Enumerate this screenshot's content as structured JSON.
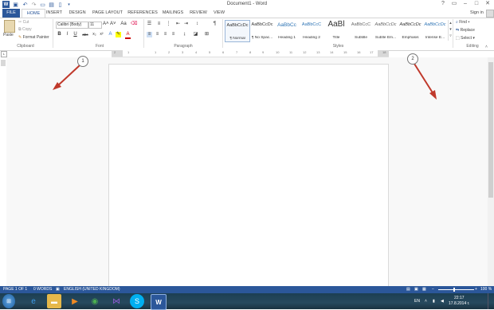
{
  "window": {
    "title": "Document1 - Word",
    "help": "?",
    "sign_in": "Sign in"
  },
  "tabs": [
    "FILE",
    "HOME",
    "INSERT",
    "DESIGN",
    "PAGE LAYOUT",
    "REFERENCES",
    "MAILINGS",
    "REVIEW",
    "VIEW"
  ],
  "clipboard": {
    "paste": "Paste",
    "cut": "Cut",
    "copy": "Copy",
    "format_painter": "Format Painter",
    "label": "Clipboard"
  },
  "font": {
    "name": "Calibri (Body)",
    "size": "11",
    "bold": "B",
    "italic": "I",
    "underline": "U",
    "strike": "abc",
    "sub": "x₂",
    "sup": "x²",
    "grow": "A˄",
    "shrink": "A˅",
    "case": "Aa",
    "label": "Font"
  },
  "paragraph": {
    "label": "Paragraph",
    "pilcrow": "¶"
  },
  "styles": {
    "label": "Styles",
    "items": [
      {
        "sample": "AaBbCcDc",
        "name": "¶ Normal"
      },
      {
        "sample": "AaBbCcDc",
        "name": "¶ No Spac..."
      },
      {
        "sample": "AaBbCc",
        "name": "Heading 1"
      },
      {
        "sample": "AaBbCcC",
        "name": "Heading 2"
      },
      {
        "sample": "AaBl",
        "name": "Title"
      },
      {
        "sample": "AaBbCcC",
        "name": "Subtitle"
      },
      {
        "sample": "AaBbCcDc",
        "name": "Subtle Em..."
      },
      {
        "sample": "AaBbCcDc",
        "name": "Emphasis"
      },
      {
        "sample": "AaBbCcDc",
        "name": "Intense E..."
      }
    ]
  },
  "editing": {
    "find": "Find",
    "replace": "Replace",
    "select": "Select",
    "label": "Editing"
  },
  "ruler": {
    "numbers": [
      "2",
      "1",
      "1",
      "2",
      "3",
      "4",
      "5",
      "6",
      "7",
      "8",
      "9",
      "10",
      "11",
      "12",
      "13",
      "14",
      "15",
      "16",
      "17",
      "18",
      "19"
    ]
  },
  "callouts": {
    "one": "1",
    "two": "2"
  },
  "status": {
    "page": "PAGE 1 OF 1",
    "words": "0 WORDS",
    "language": "ENGLISH (UNITED KINGDOM)",
    "zoom": "100 %"
  },
  "taskbar": {
    "lang": "EN",
    "time": "22:17",
    "date": "17.8.2014 г."
  },
  "colors": {
    "word_blue": "#2b579a",
    "arrow_red": "#c0392b"
  }
}
